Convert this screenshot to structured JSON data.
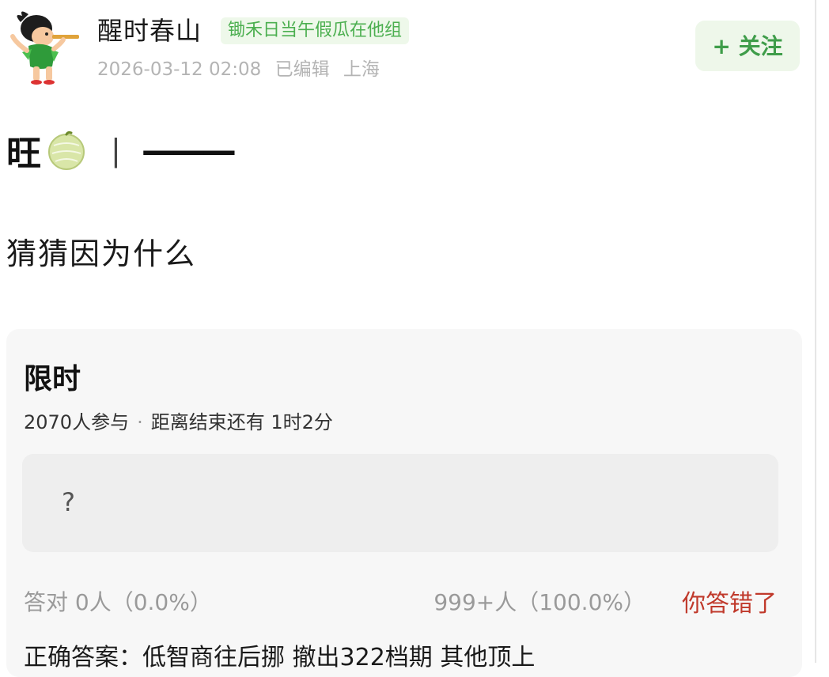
{
  "header": {
    "username": "醒时春山",
    "tag": "锄禾日当午假瓜在他组",
    "date": "2026-03-12 02:08",
    "edited": "已编辑",
    "location": "上海",
    "follow_label": "+ 关注"
  },
  "post": {
    "title_char": "旺",
    "title_sep": "|",
    "title_dash": "———",
    "body": "猜猜因为什么"
  },
  "quiz": {
    "title": "限时",
    "participants": "2070人参与",
    "separator": "·",
    "countdown": "距离结束还有 1时2分",
    "option": "?",
    "correct_stat": "答对  0人（0.0%）",
    "wrong_stat": "999+人（100.0%）",
    "result": "你答错了",
    "answer": "正确答案：低智商往后挪 撤出322档期 其他顶上"
  },
  "colors": {
    "accent_green": "#3f9d4a",
    "tag_green": "#4caf50",
    "error_red": "#c0392b"
  },
  "icons": {
    "avatar": "cartoon-boy-avatar",
    "melon": "melon-emoji"
  }
}
